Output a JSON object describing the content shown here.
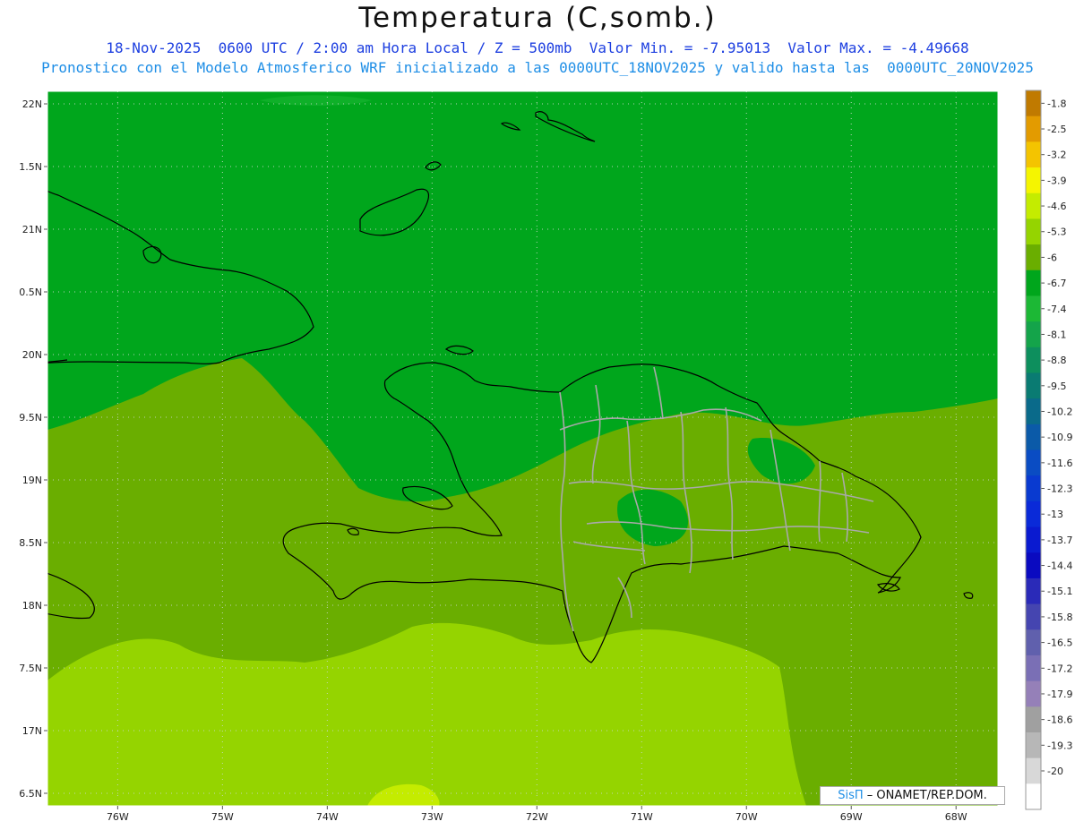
{
  "title": "Temperatura (C,somb.)",
  "subtitle_line1": "18-Nov-2025  0600 UTC / 2:00 am Hora Local / Z = 500mb  Valor Min. = -7.95013  Valor Max. = -4.49668",
  "subtitle_line2": "Pronostico con el Modelo Atmosferico WRF inicializado a las 0000UTC_18NOV2025 y valido hasta las  0000UTC_20NOV2025",
  "credit": {
    "brand": "SisΠ",
    "text": "– ONAMET/REP.DOM."
  },
  "colors": {
    "land_outline": "#000000",
    "province_outline": "#a9a9a9",
    "grid": "#b8c8b8"
  },
  "chart_data": {
    "type": "heatmap",
    "variable": "Temperatura (C,somb.)",
    "level": "500mb",
    "valid": "18-Nov-2025 0600 UTC",
    "value_min": -7.95013,
    "value_max": -4.49668,
    "lon_ticks": [
      "76W",
      "75W",
      "74W",
      "73W",
      "72W",
      "71W",
      "70W",
      "69W",
      "68W"
    ],
    "lat_ticks": [
      "22N",
      "1.5N",
      "21N",
      "0.5N",
      "20N",
      "9.5N",
      "19N",
      "8.5N",
      "18N",
      "7.5N",
      "17N",
      "6.5N"
    ],
    "lon_range": [
      -76.67,
      -67.6
    ],
    "lat_range": [
      16.4,
      22.1
    ],
    "colorbar": [
      {
        "label": "-1.8",
        "color": "#c07a00"
      },
      {
        "label": "-2.5",
        "color": "#e39b00"
      },
      {
        "label": "-3.2",
        "color": "#f4c400"
      },
      {
        "label": "-3.9",
        "color": "#f5f500"
      },
      {
        "label": "-4.6",
        "color": "#c4ec00"
      },
      {
        "label": "-5.3",
        "color": "#95d400"
      },
      {
        "label": "-6",
        "color": "#6aae00"
      },
      {
        "label": "-6.7",
        "color": "#00a61c"
      },
      {
        "label": "-7.4",
        "color": "#1cb835"
      },
      {
        "label": "-8.1",
        "color": "#14a44a"
      },
      {
        "label": "-8.8",
        "color": "#0d8f5d"
      },
      {
        "label": "-9.5",
        "color": "#0a7b72"
      },
      {
        "label": "-10.2",
        "color": "#0a6a8a"
      },
      {
        "label": "-10.9",
        "color": "#0b5aa8"
      },
      {
        "label": "-11.6",
        "color": "#0a4cc3"
      },
      {
        "label": "-12.3",
        "color": "#093ad0"
      },
      {
        "label": "-13",
        "color": "#0a2ad8"
      },
      {
        "label": "-13.7",
        "color": "#0a1ad0"
      },
      {
        "label": "-14.4",
        "color": "#0a0ac0"
      },
      {
        "label": "-15.1",
        "color": "#2a2ab8"
      },
      {
        "label": "-15.8",
        "color": "#4545b0"
      },
      {
        "label": "-16.5",
        "color": "#6060ad"
      },
      {
        "label": "-17.2",
        "color": "#7a6fb5"
      },
      {
        "label": "-17.9",
        "color": "#9580b8"
      },
      {
        "label": "-18.6",
        "color": "#a0a0a0"
      },
      {
        "label": "-19.3",
        "color": "#b7b7b7"
      },
      {
        "label": "-20",
        "color": "#d8d8d8"
      },
      {
        "label": "",
        "color": "#ffffff"
      }
    ],
    "field_bands": [
      {
        "name": "north",
        "value_range": [
          -7.4,
          -6.7
        ],
        "color": "#00a61c"
      },
      {
        "name": "central",
        "value_range": [
          -6.7,
          -6.0
        ],
        "color": "#6aae00"
      },
      {
        "name": "south",
        "value_range": [
          -6.0,
          -5.3
        ],
        "color": "#95d400"
      },
      {
        "name": "far-south",
        "value_range": [
          -5.3,
          -4.6
        ],
        "color": "#c4ec00"
      }
    ]
  }
}
